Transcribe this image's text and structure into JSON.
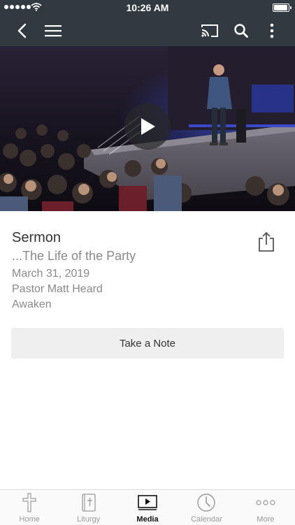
{
  "status_bar": {
    "time": "10:26 AM"
  },
  "nav": {
    "back_icon": "chevron-left-icon",
    "menu_icon": "hamburger-icon",
    "cast_icon": "cast-icon",
    "search_icon": "search-icon",
    "more_icon": "vertical-dots-icon",
    "bar_color": "#323a41"
  },
  "media": {
    "category": "Sermon",
    "title": "...The Life of the Party",
    "date": "March 31, 2019",
    "speaker": "Pastor Matt Heard",
    "series": "Awaken",
    "share_icon": "share-icon",
    "play_icon": "play-icon"
  },
  "actions": {
    "take_note_label": "Take a Note"
  },
  "tabs": [
    {
      "label": "Home",
      "icon": "cross-icon",
      "active": false
    },
    {
      "label": "Liturgy",
      "icon": "bible-icon",
      "active": false
    },
    {
      "label": "Media",
      "icon": "video-player-icon",
      "active": true
    },
    {
      "label": "Calendar",
      "icon": "clock-icon",
      "active": false
    },
    {
      "label": "More",
      "icon": "ellipsis-icon",
      "active": false
    }
  ]
}
